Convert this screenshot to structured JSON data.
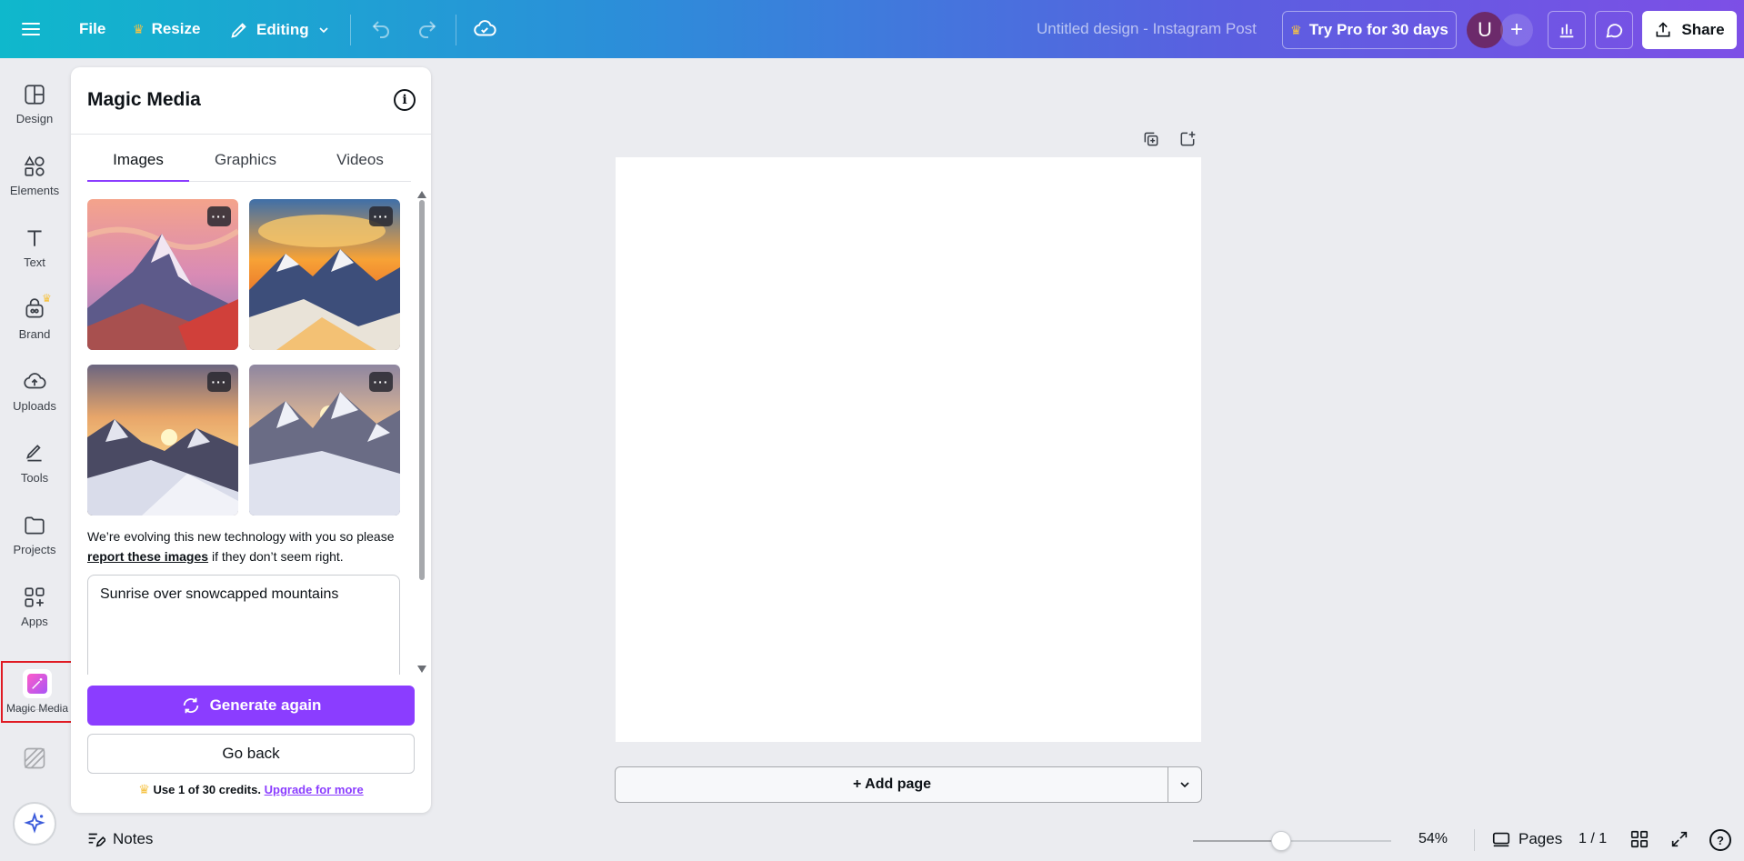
{
  "topbar": {
    "file_label": "File",
    "resize_label": "Resize",
    "editing_label": "Editing",
    "doc_title": "Untitled design - Instagram Post",
    "pro_label": "Try Pro for 30 days",
    "avatar_initial": "U",
    "share_label": "Share"
  },
  "rail": {
    "items": [
      {
        "label": "Design",
        "icon": "design-icon"
      },
      {
        "label": "Elements",
        "icon": "elements-icon"
      },
      {
        "label": "Text",
        "icon": "text-icon"
      },
      {
        "label": "Brand",
        "icon": "brand-icon"
      },
      {
        "label": "Uploads",
        "icon": "uploads-icon"
      },
      {
        "label": "Tools",
        "icon": "tools-icon"
      },
      {
        "label": "Projects",
        "icon": "projects-icon"
      },
      {
        "label": "Apps",
        "icon": "apps-icon"
      }
    ],
    "active_label": "Magic Media"
  },
  "panel": {
    "title": "Magic Media",
    "tabs": [
      "Images",
      "Graphics",
      "Videos"
    ],
    "active_tab": "Images",
    "notice_prefix": "We’re evolving this new technology with you so please ",
    "notice_link": "report these images",
    "notice_suffix": " if they don’t seem right.",
    "prompt": "Sunrise over snowcapped mountains",
    "generate_label": "Generate again",
    "back_label": "Go back",
    "credits_text": "Use 1 of 30 credits.",
    "credits_link": "Upgrade for more"
  },
  "canvas": {
    "add_page_label": "+ Add page"
  },
  "bottombar": {
    "notes_label": "Notes",
    "zoom": "54%",
    "pages_label": "Pages",
    "page_count": "1 / 1",
    "help_label": "?"
  },
  "colors": {
    "accent": "#8b3dff",
    "highlight": "#e01b24"
  }
}
